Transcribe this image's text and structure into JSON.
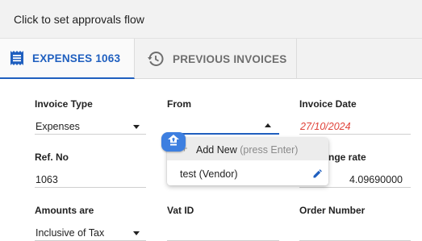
{
  "approvals": {
    "text": "Click to set approvals flow"
  },
  "tabs": [
    {
      "label": "EXPENSES 1063",
      "icon": "receipt-icon",
      "active": true
    },
    {
      "label": "PREVIOUS INVOICES",
      "icon": "history-icon",
      "active": false
    }
  ],
  "form": {
    "invoice_type": {
      "label": "Invoice Type",
      "value": "Expenses"
    },
    "from": {
      "label": "From",
      "value": ""
    },
    "invoice_date": {
      "label": "Invoice Date",
      "value": "27/10/2024"
    },
    "ref_no": {
      "label": "Ref. No",
      "value": "1063"
    },
    "exchange_rate": {
      "label": "nge rate",
      "value": "4.09690000"
    },
    "amounts_are": {
      "label": "Amounts are",
      "value": "Inclusive of Tax"
    },
    "vat_id": {
      "label": "Vat ID",
      "value": ""
    },
    "order_number": {
      "label": "Order Number",
      "value": ""
    }
  },
  "dropdown": {
    "add_new": {
      "label": "Add New",
      "hint": "(press Enter)",
      "icon": "plus-icon"
    },
    "options": [
      {
        "label": "test (Vendor)",
        "icon": "pencil-icon"
      }
    ]
  },
  "colors": {
    "accent": "#1f5fbf",
    "date": "#e0433a",
    "fab": "#3d7fe0"
  }
}
